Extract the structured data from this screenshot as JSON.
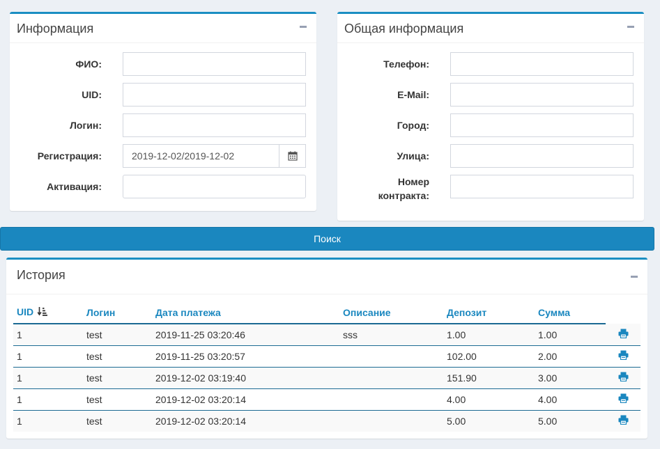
{
  "info_panel": {
    "title": "Информация",
    "fields": [
      {
        "label": "ФИО:",
        "value": ""
      },
      {
        "label": "UID:",
        "value": ""
      },
      {
        "label": "Логин:",
        "value": ""
      },
      {
        "label": "Регистрация:",
        "value": "2019-12-02/2019-12-02"
      },
      {
        "label": "Активация:",
        "value": ""
      }
    ]
  },
  "general_panel": {
    "title": "Общая информация",
    "fields": [
      {
        "label": "Телефон:",
        "value": ""
      },
      {
        "label": "E-Mail:",
        "value": ""
      },
      {
        "label": "Город:",
        "value": ""
      },
      {
        "label": "Улица:",
        "value": ""
      },
      {
        "label": "Номер контракта:",
        "label_line1": "Номер",
        "label_line2": "контракта:",
        "value": ""
      }
    ]
  },
  "search_button": {
    "label": "Поиск"
  },
  "history": {
    "title": "История",
    "columns": [
      "UID",
      "Логин",
      "Дата платежа",
      "Описание",
      "Депозит",
      "Сумма"
    ],
    "rows": [
      {
        "uid": "1",
        "login": "test",
        "date": "2019-11-25 03:20:46",
        "desc": "sss",
        "deposit": "1.00",
        "sum": "1.00"
      },
      {
        "uid": "1",
        "login": "test",
        "date": "2019-11-25 03:20:57",
        "desc": "",
        "deposit": "102.00",
        "sum": "2.00"
      },
      {
        "uid": "1",
        "login": "test",
        "date": "2019-12-02 03:19:40",
        "desc": "",
        "deposit": "151.90",
        "sum": "3.00"
      },
      {
        "uid": "1",
        "login": "test",
        "date": "2019-12-02 03:20:14",
        "desc": "",
        "deposit": "4.00",
        "sum": "4.00"
      },
      {
        "uid": "1",
        "login": "test",
        "date": "2019-12-02 03:20:14",
        "desc": "",
        "deposit": "5.00",
        "sum": "5.00"
      }
    ]
  },
  "colors": {
    "accent": "#1a87bf",
    "background": "#ecf0f5"
  },
  "icons": {
    "collapse": "minus-icon",
    "calendar": "calendar-icon",
    "sort": "sort-amount-icon",
    "print": "print-icon"
  }
}
